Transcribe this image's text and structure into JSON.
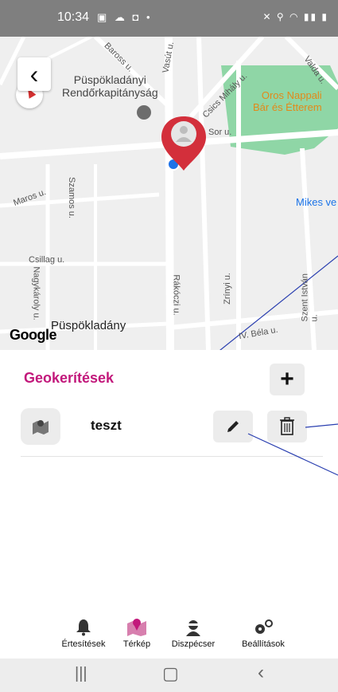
{
  "status_bar": {
    "time": "10:34"
  },
  "map": {
    "labels": {
      "police": "Püspökladányi\nRendőrkapitányság",
      "restaurant": "Oros Nappali\nBár és Étterem",
      "mikes": "Mikes ve",
      "town": "Püspökladány",
      "baross": "Baross u.",
      "vasut": "Vasút u.",
      "csics": "Csics Mihály u.",
      "valda": "Valda u.",
      "sor": "Sor u.",
      "maros": "Maros u.",
      "szamos": "Szamos u.",
      "csillag": "Csillag u.",
      "nagykaroly": "Nagykároly u.",
      "rakoczi": "Rákóczi u.",
      "zrinyi": "Zrínyi u.",
      "szentistvan": "Szent István u.",
      "bela": "IV. Béla u."
    },
    "google": "Google"
  },
  "panel": {
    "title": "Geokerítések",
    "items": [
      {
        "name": "teszt"
      }
    ]
  },
  "tabs": [
    {
      "label": "Értesítések",
      "icon": "bell-icon"
    },
    {
      "label": "Térkép",
      "icon": "map-icon"
    },
    {
      "label": "Diszpécser",
      "icon": "dispatcher-icon"
    },
    {
      "label": "Beállítások",
      "icon": "gears-icon"
    }
  ],
  "colors": {
    "accent": "#c2187b",
    "pin": "#d32f3b",
    "park": "#8fd6a6"
  }
}
